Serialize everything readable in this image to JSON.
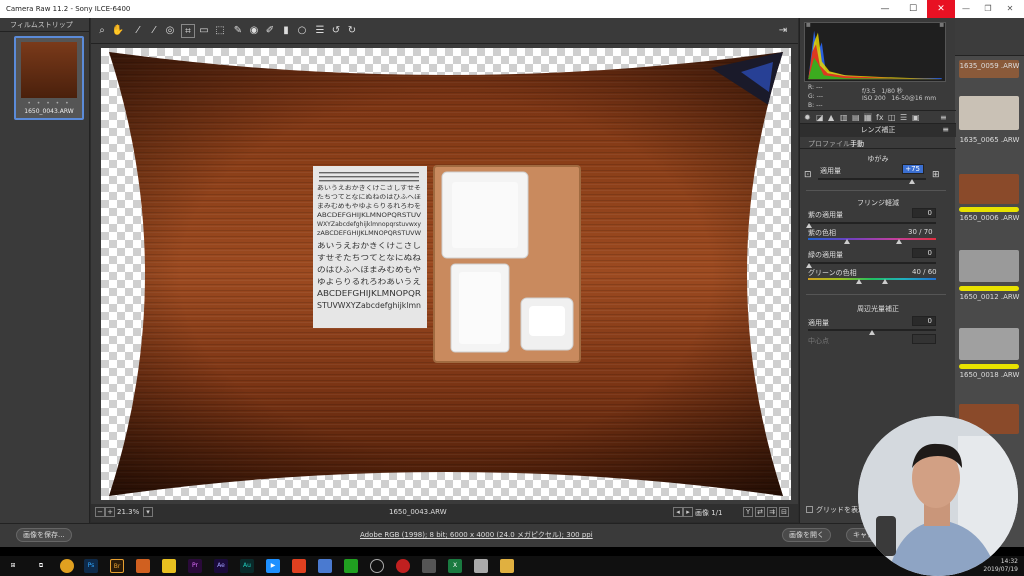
{
  "window": {
    "title": "Camera Raw 11.2 - Sony ILCE-6400"
  },
  "filmstrip": {
    "header": "フィルムストリップ",
    "stars": "• • • • •",
    "thumb_name": "1650_0043.ARW"
  },
  "status": {
    "zoom": "21.3%",
    "filename": "1650_0043.ARW",
    "image_count": "画像 1/1"
  },
  "histogram": {
    "r_label": "R:",
    "g_label": "G:",
    "b_label": "B:",
    "r_value": "---",
    "g_value": "---",
    "b_value": "---",
    "aperture": "f/3.5",
    "shutter": "1/80 秒",
    "iso": "ISO 200",
    "lens": "16-50@16 mm"
  },
  "panel": {
    "section_title": "レンズ補正",
    "tab_profile": "プロファイル",
    "tab_manual": "手動",
    "distortion": {
      "heading": "ゆがみ",
      "amount_label": "適用量",
      "amount_value": "+75",
      "amount_fraction": 0.87
    },
    "defringe": {
      "heading": "フリンジ軽減",
      "purple_amount_label": "紫の適用量",
      "purple_amount_value": "0",
      "purple_hue_label": "紫の色相",
      "purple_hue_value": "30 / 70",
      "green_amount_label": "緑の適用量",
      "green_amount_value": "0",
      "green_hue_label": "グリーンの色相",
      "green_hue_value": "40 / 60"
    },
    "vignette": {
      "heading": "周辺光量補正",
      "amount_label": "適用量",
      "amount_value": "0",
      "midpoint_label": "中心点"
    },
    "grid_label": "グリッドを表示"
  },
  "bottombar": {
    "save_label": "画像を保存...",
    "workflow_link": "Adobe RGB (1998); 8 bit; 6000 x 4000 (24.0 メガピクセル); 300 ppi",
    "open_label": "画像を開く",
    "cancel_label": "キャン"
  },
  "background_app": {
    "labels": [
      "1635_0059 .ARW",
      "1635_0065 .ARW",
      "1650_0006 .ARW",
      "1650_0012 .ARW",
      "1650_0018 .ARW"
    ]
  },
  "document": {
    "lines": [
      "あいうえおかきくけこさしすせそ",
      "たちつてとなにぬねのはひふへほ",
      "まみむめもやゆよらりるれろわを",
      "ABCDEFGHIJKLMNOPQRSTUV",
      "WXYZabcdefghijklmnopqrstuvwxy",
      "zABCDEFGHIJKLMNOPQRSTUVW",
      "あいうえおかきくけこさし",
      "すせそたちつてとなにぬね",
      "のはひふへほまみむめもや",
      "ゆよらりるれろわあいうえ",
      "ABCDEFGHIJKLMNOPQR",
      "STUVWXYZabcdefghijklmn"
    ]
  },
  "clock": {
    "time": "14:32",
    "date": "2019/07/19"
  },
  "colors": {
    "accent": "#5b8bd9",
    "highlight": "#e8e200"
  }
}
